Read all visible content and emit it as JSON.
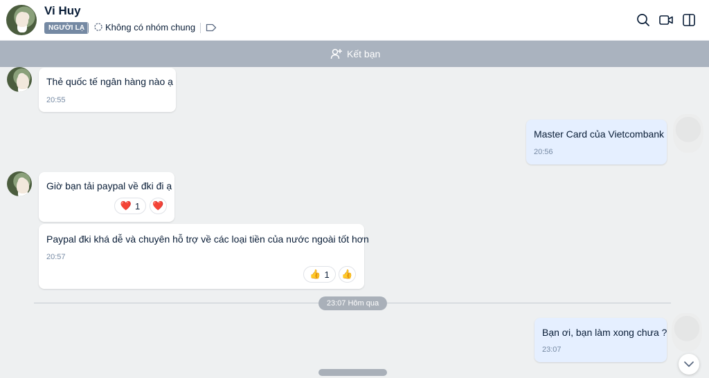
{
  "header": {
    "name": "Vi Huy",
    "badge": "NGƯỜI LẠ",
    "group_text": "Không có nhóm chung",
    "icons": [
      "avatar",
      "group-icon",
      "tag-icon",
      "search-icon",
      "video-call-icon",
      "panel-toggle-icon"
    ]
  },
  "friend_bar": {
    "label": "Kết bạn",
    "icon": "add-friend-icon"
  },
  "messages": [
    {
      "sender": "other",
      "text": "Thẻ quốc tế ngân hàng nào ạ",
      "time": "20:55"
    },
    {
      "sender": "me",
      "text": "Master Card của Vietcombank",
      "time": "20:56"
    },
    {
      "sender": "other",
      "text": "Giờ bạn tải paypal về đki đi ạ",
      "time": "",
      "reaction": {
        "emoji": "❤️",
        "count": "1"
      }
    },
    {
      "sender": "other",
      "text": "Paypal đki khá dễ và chuyên hỗ trợ về các loại tiền của nước ngoài tốt hơn",
      "time": "20:57",
      "reaction": {
        "emoji": "👍",
        "count": "1"
      }
    },
    {
      "sender": "me",
      "text": "Bạn ơi, bạn làm xong chưa ?",
      "time": "23:07"
    }
  ],
  "date_divider": "23:07 Hôm qua",
  "colors": {
    "accent": "#0068ff",
    "mine_bubble": "#e5efff",
    "badge": "#7589a3",
    "friend_bar": "#aab3bf"
  }
}
